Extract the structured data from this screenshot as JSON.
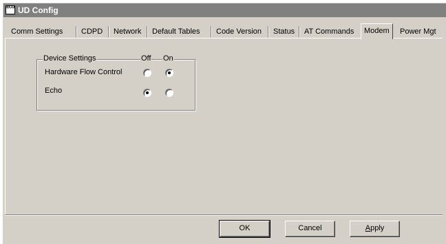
{
  "window": {
    "icon_text": "ECO",
    "title": "UD Config"
  },
  "tabs": [
    {
      "label": "Comm Settings",
      "active": false
    },
    {
      "label": "CDPD",
      "active": false
    },
    {
      "label": "Network",
      "active": false
    },
    {
      "label": "Default Tables",
      "active": false
    },
    {
      "label": "Code Version",
      "active": false
    },
    {
      "label": "Status",
      "active": false
    },
    {
      "label": "AT Commands",
      "active": false
    },
    {
      "label": "Modem",
      "active": true
    },
    {
      "label": "Power Mgt",
      "active": false
    }
  ],
  "device_settings": {
    "header": "Device Settings",
    "col_off": "Off",
    "col_on": "On",
    "rows": [
      {
        "label": "Hardware Flow Control",
        "value": "On"
      },
      {
        "label": "Echo",
        "value": "Off"
      }
    ]
  },
  "buttons": {
    "ok": "OK",
    "cancel": "Cancel",
    "apply_pre": "",
    "apply_u": "A",
    "apply_post": "pply"
  }
}
